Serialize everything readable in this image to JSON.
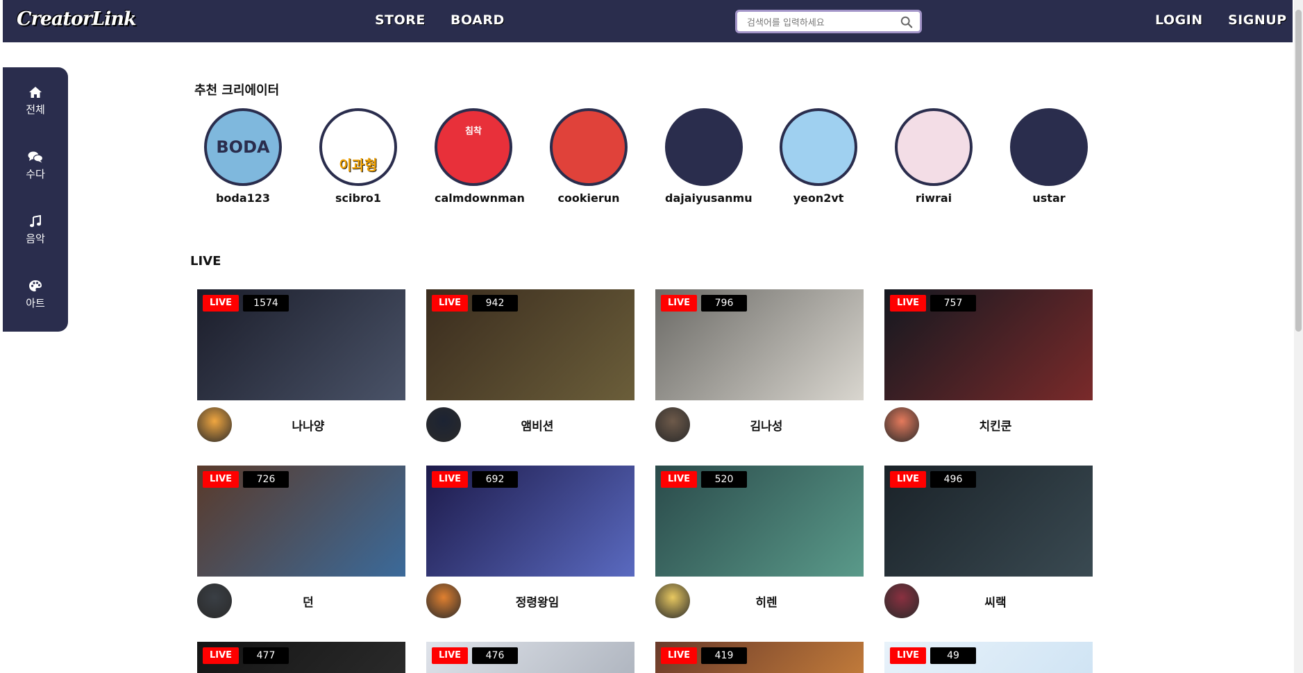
{
  "header": {
    "logo": "CreatorLink",
    "nav": [
      "STORE",
      "BOARD"
    ],
    "search_placeholder": "검색어를 입력하세요",
    "login": "LOGIN",
    "signup": "SIGNUP"
  },
  "sidebar": {
    "items": [
      {
        "label": "전체",
        "icon": "home-icon"
      },
      {
        "label": "수다",
        "icon": "chat-icon"
      },
      {
        "label": "음악",
        "icon": "music-icon"
      },
      {
        "label": "아트",
        "icon": "palette-icon"
      }
    ]
  },
  "recommended": {
    "title": "추천 크리에이터",
    "creators": [
      {
        "name": "boda123",
        "avatar_text": "BODA",
        "bg": "#7fb8dd"
      },
      {
        "name": "scibro1",
        "avatar_text": "이과형",
        "bg": "#ffffff"
      },
      {
        "name": "calmdownman",
        "avatar_text": "침착",
        "bg": "#e8303a"
      },
      {
        "name": "cookierun",
        "avatar_text": "",
        "bg": "#e0423a"
      },
      {
        "name": "dajaiyusanmu",
        "avatar_text": "",
        "bg": "#2a2d4d"
      },
      {
        "name": "yeon2vt",
        "avatar_text": "",
        "bg": "#9fd0f0"
      },
      {
        "name": "riwrai",
        "avatar_text": "",
        "bg": "#f3dde6"
      },
      {
        "name": "ustar",
        "avatar_text": "",
        "bg": "#2a2d4d"
      }
    ]
  },
  "live": {
    "title": "LIVE",
    "badge": "LIVE",
    "streams": [
      {
        "name": "나나양",
        "viewers": "1574",
        "thumb": [
          "#1b1d2a",
          "#4a5368"
        ],
        "avatar": "#f0a640"
      },
      {
        "name": "앰비션",
        "viewers": "942",
        "thumb": [
          "#3a2c1e",
          "#6b5e3a"
        ],
        "avatar": "#1c2333"
      },
      {
        "name": "김나성",
        "viewers": "796",
        "thumb": [
          "#6b6a66",
          "#d9d6cf"
        ],
        "avatar": "#6e5a4a"
      },
      {
        "name": "치킨쿤",
        "viewers": "757",
        "thumb": [
          "#141820",
          "#7a2a2a"
        ],
        "avatar": "#e57a5c"
      },
      {
        "name": "던",
        "viewers": "726",
        "thumb": [
          "#5a3a2a",
          "#3b6a9a"
        ],
        "avatar": "#3a3f45"
      },
      {
        "name": "정령왕임",
        "viewers": "692",
        "thumb": [
          "#1d1a4a",
          "#5a6ac0"
        ],
        "avatar": "#e08030"
      },
      {
        "name": "히렌",
        "viewers": "520",
        "thumb": [
          "#2a4a4a",
          "#5a9a8a"
        ],
        "avatar": "#e8c860"
      },
      {
        "name": "씨랙",
        "viewers": "496",
        "thumb": [
          "#1a2228",
          "#3a4a52"
        ],
        "avatar": "#8a3040"
      },
      {
        "name": "",
        "viewers": "477",
        "thumb": [
          "#141414",
          "#2a2a2a"
        ],
        "avatar": "#444"
      },
      {
        "name": "",
        "viewers": "476",
        "thumb": [
          "#dfe3ea",
          "#b0b6c0"
        ],
        "avatar": "#444"
      },
      {
        "name": "",
        "viewers": "419",
        "thumb": [
          "#6a3a2a",
          "#c07a3a"
        ],
        "avatar": "#444"
      },
      {
        "name": "",
        "viewers": "49",
        "thumb": [
          "#e8f2fa",
          "#d0e4f4"
        ],
        "avatar": "#444"
      }
    ]
  }
}
